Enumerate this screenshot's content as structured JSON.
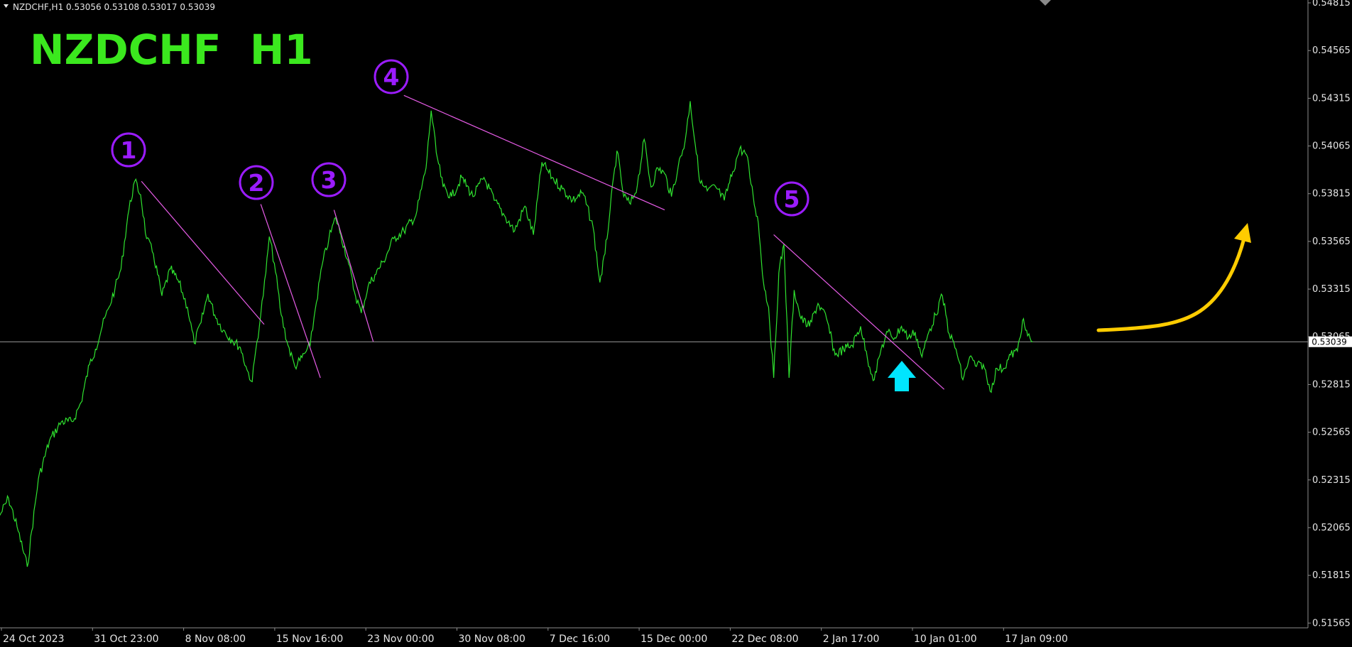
{
  "header": {
    "info_text": "NZDCHF,H1  0.53056 0.53108 0.53017 0.53039",
    "big_title": "NZDCHF  H1"
  },
  "annotations": {
    "markers": [
      "1",
      "2",
      "3",
      "4",
      "5"
    ]
  },
  "chart_data": {
    "type": "line",
    "title": "NZDCHF  H1",
    "symbol": "NZDCHF",
    "timeframe": "H1",
    "ohlc_header": {
      "open": 0.53056,
      "high": 0.53108,
      "low": 0.53017,
      "close": 0.53039
    },
    "current_price_label": "0.53039",
    "current_price": 0.53039,
    "ylim": [
      0.5154,
      0.5483
    ],
    "y_ticks": [
      "0.54815",
      "0.54565",
      "0.54315",
      "0.54065",
      "0.53815",
      "0.53565",
      "0.53315",
      "0.53065",
      "0.52815",
      "0.52565",
      "0.52315",
      "0.52065",
      "0.51815",
      "0.51565"
    ],
    "x_ticks": [
      "24 Oct 2023",
      "31 Oct 23:00",
      "8 Nov 08:00",
      "15 Nov 16:00",
      "23 Nov 00:00",
      "30 Nov 08:00",
      "7 Dec 16:00",
      "15 Dec 00:00",
      "22 Dec 08:00",
      "2 Jan 17:00",
      "10 Jan 01:00",
      "17 Jan 09:00"
    ],
    "x_index_range": [
      0,
      1525
    ],
    "series": [
      {
        "color": "#2fe22f",
        "x": [
          0,
          10,
          20,
          32,
          45,
          58,
          72,
          85,
          95,
          105,
          112,
          120,
          128,
          135,
          142,
          150,
          158,
          165,
          172,
          180,
          190,
          200,
          210,
          220,
          228,
          236,
          244,
          252,
          262,
          272,
          282,
          290,
          296,
          300,
          306,
          312,
          316,
          322,
          330,
          338,
          346,
          352,
          358,
          364,
          370,
          378,
          386,
          394,
          400,
          408,
          416,
          424,
          432,
          440,
          450,
          462,
          474,
          488,
          500,
          506,
          512,
          520,
          530,
          542,
          555,
          568,
          580,
          592,
          604,
          616,
          626,
          636,
          648,
          660,
          672,
          684,
          696,
          704,
          710,
          716,
          724,
          732,
          740,
          748,
          756,
          764,
          772,
          780,
          788,
          796,
          804,
          810,
          816,
          822,
          830,
          840,
          850,
          860,
          868,
          876,
          884,
          890,
          896,
          902,
          908,
          914,
          920,
          926,
          932,
          940,
          950,
          960,
          970,
          980,
          990,
          1000,
          1010,
          1018,
          1026,
          1034,
          1042,
          1050,
          1058,
          1066,
          1074,
          1082,
          1090,
          1098,
          1106,
          1114,
          1122,
          1130,
          1138,
          1146,
          1154,
          1162,
          1170,
          1178,
          1186,
          1194,
          1200,
          1206,
          1212
        ],
        "y": [
          0.5213,
          0.5222,
          0.5207,
          0.5186,
          0.5232,
          0.5252,
          0.5262,
          0.5262,
          0.5272,
          0.5292,
          0.53,
          0.5312,
          0.5322,
          0.5332,
          0.5342,
          0.537,
          0.5388,
          0.5381,
          0.5358,
          0.535,
          0.5328,
          0.5342,
          0.5335,
          0.5322,
          0.5303,
          0.5314,
          0.5329,
          0.5318,
          0.531,
          0.5305,
          0.5301,
          0.5289,
          0.5283,
          0.5299,
          0.5318,
          0.534,
          0.5359,
          0.5345,
          0.5318,
          0.5302,
          0.5291,
          0.5294,
          0.5298,
          0.5302,
          0.5321,
          0.5344,
          0.5358,
          0.5369,
          0.536,
          0.5347,
          0.533,
          0.5319,
          0.5333,
          0.5339,
          0.5346,
          0.5358,
          0.5362,
          0.537,
          0.5395,
          0.5425,
          0.5403,
          0.5385,
          0.538,
          0.539,
          0.538,
          0.539,
          0.5378,
          0.537,
          0.5362,
          0.5375,
          0.536,
          0.5398,
          0.539,
          0.5384,
          0.5378,
          0.5382,
          0.5364,
          0.5335,
          0.535,
          0.5373,
          0.5404,
          0.538,
          0.5376,
          0.5386,
          0.541,
          0.5385,
          0.5395,
          0.5392,
          0.538,
          0.5396,
          0.5409,
          0.543,
          0.5407,
          0.5387,
          0.5383,
          0.5385,
          0.5378,
          0.5393,
          0.5405,
          0.5402,
          0.538,
          0.5366,
          0.5335,
          0.5322,
          0.5285,
          0.534,
          0.5355,
          0.5285,
          0.5331,
          0.5316,
          0.5312,
          0.5324,
          0.5316,
          0.5297,
          0.53,
          0.5302,
          0.5312,
          0.5295,
          0.5284,
          0.53,
          0.5309,
          0.5306,
          0.5312,
          0.5306,
          0.5309,
          0.5296,
          0.5309,
          0.5318,
          0.5328,
          0.5308,
          0.53,
          0.5284,
          0.5296,
          0.5291,
          0.5292,
          0.5278,
          0.529,
          0.529,
          0.5297,
          0.5299,
          0.5315,
          0.5307,
          0.5304
        ]
      }
    ],
    "trendlines": [
      {
        "from": [
          166,
          0.5388
        ],
        "to": [
          310,
          0.5313
        ]
      },
      {
        "from": [
          306,
          0.5376
        ],
        "to": [
          376,
          0.5285
        ]
      },
      {
        "from": [
          392,
          0.5373
        ],
        "to": [
          438,
          0.5304
        ]
      },
      {
        "from": [
          474,
          0.5433
        ],
        "to": [
          780,
          0.5373
        ]
      },
      {
        "from": [
          908,
          0.536
        ],
        "to": [
          1108,
          0.5279
        ]
      }
    ],
    "grid": false,
    "legend": "none",
    "colors": {
      "background": "#000000",
      "price_line": "#2fe22f",
      "title": "#3be81e",
      "markers": "#9b1cff",
      "trendlines": "#e75ce7",
      "axis": "#8c8c8c",
      "axis_text": "#e6e6e6",
      "current_line": "#9a9a9a",
      "arrow_up": "#00e5ff",
      "curved_arrow": "#ffcc00"
    }
  }
}
